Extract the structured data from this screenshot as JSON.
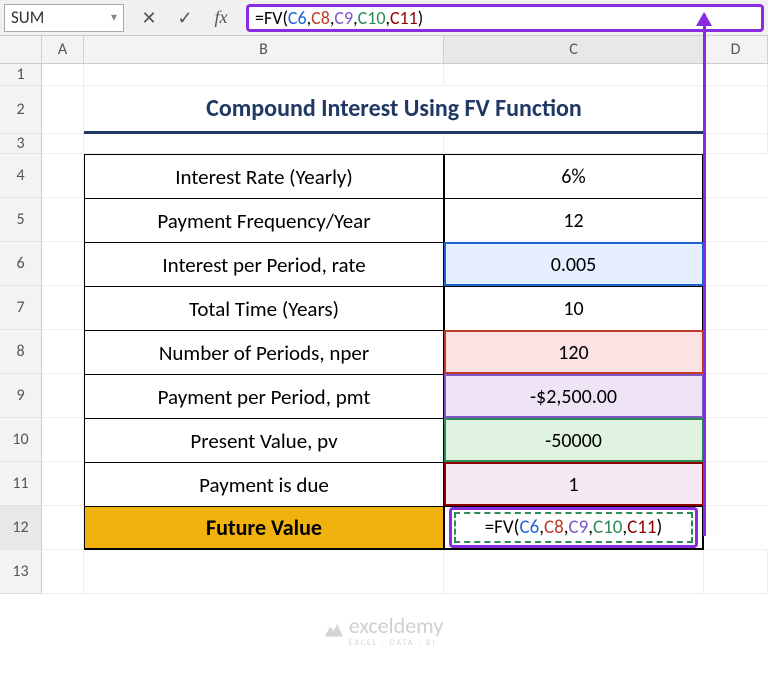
{
  "formula_bar": {
    "namebox": "SUM",
    "formula_parts": {
      "prefix": "=FV(",
      "c6": "C6",
      "c8": "C8",
      "c9": "C9",
      "c10": "C10",
      "c11": "C11",
      "comma": ",",
      "suffix": ")"
    }
  },
  "columns": {
    "blank": "",
    "A": "A",
    "B": "B",
    "C": "C",
    "D": "D"
  },
  "row_nums": {
    "r1": "1",
    "r2": "2",
    "r3": "3",
    "r4": "4",
    "r5": "5",
    "r6": "6",
    "r7": "7",
    "r8": "8",
    "r9": "9",
    "r10": "10",
    "r11": "11",
    "r12": "12",
    "r13": "13"
  },
  "title": "Compound Interest Using FV Function",
  "rows": {
    "r4": {
      "label": "Interest Rate (Yearly)",
      "value": "6%"
    },
    "r5": {
      "label": "Payment Frequency/Year",
      "value": "12"
    },
    "r6": {
      "label": "Interest per Period, rate",
      "value": "0.005"
    },
    "r7": {
      "label": "Total Time (Years)",
      "value": "10"
    },
    "r8": {
      "label": "Number of Periods, nper",
      "value": "120"
    },
    "r9": {
      "label": "Payment per Period, pmt",
      "value": "-$2,500.00"
    },
    "r10": {
      "label": "Present Value, pv",
      "value": "-50000"
    },
    "r11": {
      "label": "Payment is due",
      "value": "1"
    },
    "r12": {
      "label": "Future Value",
      "value": "=FV(C6,C8,C9,C10,C11)"
    }
  },
  "watermark": {
    "brand": "exceldemy",
    "sub": "EXCEL · DATA · BI"
  },
  "chart_data": {
    "type": "table",
    "title": "Compound Interest Using FV Function",
    "parameters": [
      {
        "name": "Interest Rate (Yearly)",
        "value": 0.06,
        "display": "6%"
      },
      {
        "name": "Payment Frequency/Year",
        "value": 12
      },
      {
        "name": "Interest per Period, rate",
        "value": 0.005,
        "cell": "C6"
      },
      {
        "name": "Total Time (Years)",
        "value": 10
      },
      {
        "name": "Number of Periods, nper",
        "value": 120,
        "cell": "C8"
      },
      {
        "name": "Payment per Period, pmt",
        "value": -2500.0,
        "display": "-$2,500.00",
        "cell": "C9"
      },
      {
        "name": "Present Value, pv",
        "value": -50000,
        "cell": "C10"
      },
      {
        "name": "Payment is due",
        "value": 1,
        "cell": "C11"
      }
    ],
    "result": {
      "name": "Future Value",
      "formula": "=FV(C6,C8,C9,C10,C11)",
      "cell": "C12"
    }
  }
}
